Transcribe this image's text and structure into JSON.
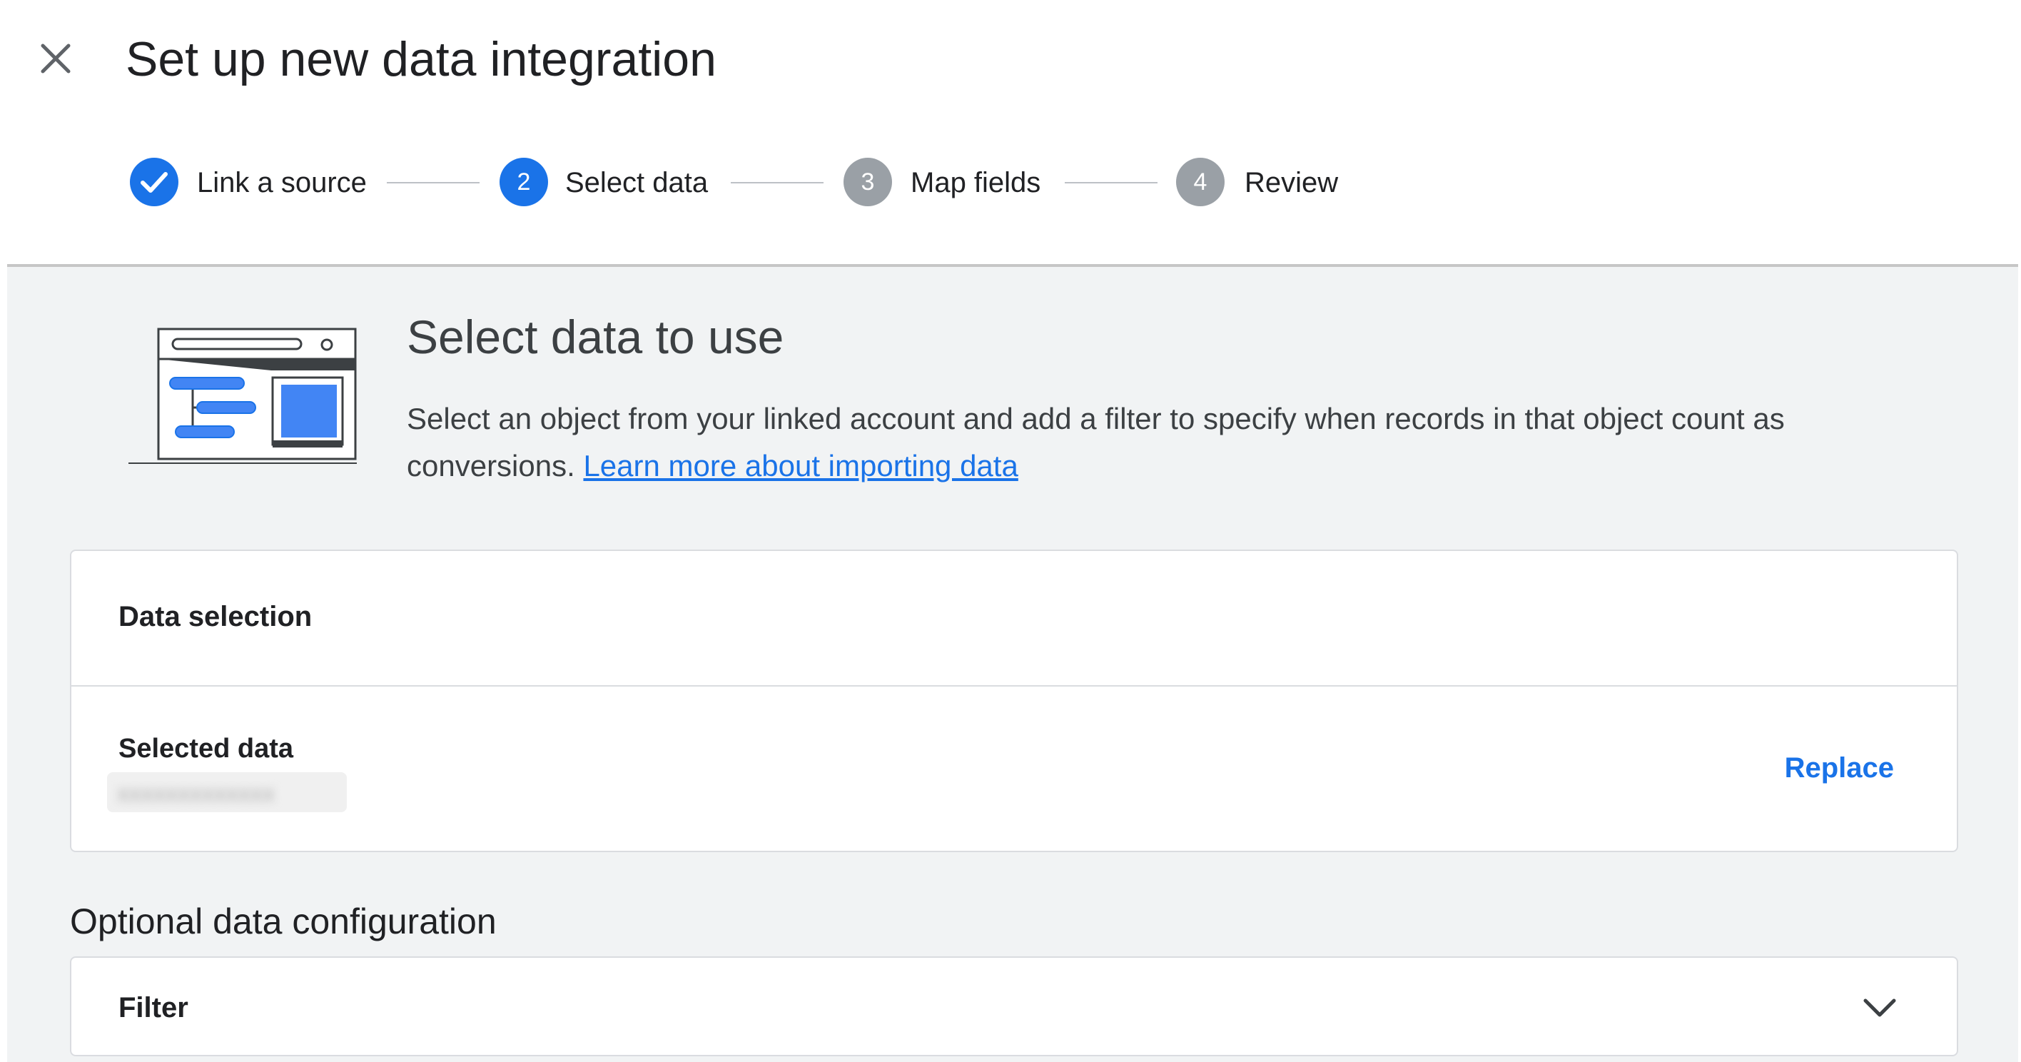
{
  "dialog": {
    "title": "Set up new data integration"
  },
  "stepper": {
    "steps": [
      {
        "number": "1",
        "label": "Link a source",
        "state": "completed"
      },
      {
        "number": "2",
        "label": "Select data",
        "state": "active"
      },
      {
        "number": "3",
        "label": "Map fields",
        "state": "pending"
      },
      {
        "number": "4",
        "label": "Review",
        "state": "pending"
      }
    ]
  },
  "intro": {
    "title": "Select data to use",
    "description": "Select an object from your linked account and add a filter to specify when records in that object count as conversions.",
    "link_text": "Learn more about importing data"
  },
  "data_selection": {
    "header": "Data selection",
    "selected_label": "Selected data",
    "selected_value": "xxxxxxxxxxxxx",
    "replace_label": "Replace"
  },
  "optional": {
    "title": "Optional data configuration",
    "filter_label": "Filter"
  },
  "colors": {
    "accent": "#1a73e8",
    "step_pending": "#9aa0a6",
    "panel_bg": "#f1f3f4"
  },
  "icons": {
    "close": "close-icon",
    "step_done": "check-icon",
    "expand": "chevron-down-icon"
  }
}
